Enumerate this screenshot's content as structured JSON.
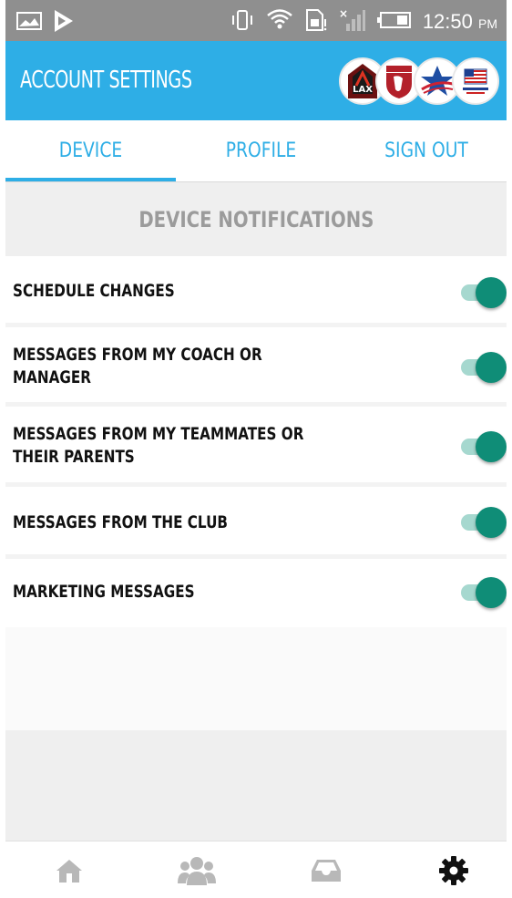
{
  "status_bar": {
    "time": "12:50",
    "ampm": "PM",
    "icons": [
      "gallery-icon",
      "play-store-icon",
      "vibrate-icon",
      "wifi-icon",
      "sim-icon",
      "no-signal-icon",
      "battery-icon"
    ]
  },
  "header": {
    "title": "ACCOUNT SETTINGS",
    "logos": [
      {
        "name": "club-logo-lax",
        "text": "LAX"
      },
      {
        "name": "club-logo-shield",
        "text": ""
      },
      {
        "name": "club-logo-star",
        "text": ""
      },
      {
        "name": "club-logo-soccer",
        "text": ""
      }
    ]
  },
  "tabs": [
    {
      "label": "DEVICE",
      "active": true
    },
    {
      "label": "PROFILE",
      "active": false
    },
    {
      "label": "SIGN OUT",
      "active": false
    }
  ],
  "section_title": "DEVICE NOTIFICATIONS",
  "notifications": [
    {
      "label": "SCHEDULE CHANGES",
      "enabled": true
    },
    {
      "label": "MESSAGES FROM MY COACH OR MANAGER",
      "enabled": true
    },
    {
      "label": "MESSAGES FROM MY TEAMMATES OR THEIR PARENTS",
      "enabled": true
    },
    {
      "label": "MESSAGES FROM THE CLUB",
      "enabled": true
    },
    {
      "label": "MARKETING MESSAGES",
      "enabled": true
    }
  ],
  "bottom_nav": [
    {
      "name": "home-icon",
      "active": false
    },
    {
      "name": "team-icon",
      "active": false
    },
    {
      "name": "inbox-icon",
      "active": false
    },
    {
      "name": "gear-icon",
      "active": true
    }
  ],
  "colors": {
    "accent": "#2eaee6",
    "toggle_on": "#0f8d77",
    "toggle_track": "#a6d8cf",
    "status_bar": "#8f8f8f"
  }
}
